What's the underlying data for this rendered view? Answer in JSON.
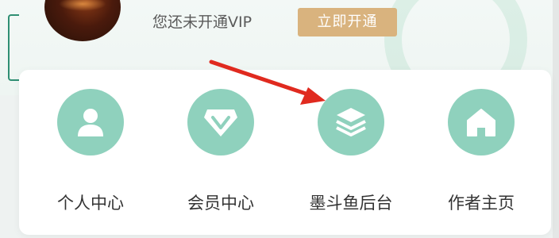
{
  "profile": {
    "vip_status": "您还未开通VIP",
    "vip_button_label": "立即开通"
  },
  "menu": {
    "items": [
      {
        "label": "个人中心",
        "icon": "person-icon"
      },
      {
        "label": "会员中心",
        "icon": "vip-diamond-icon"
      },
      {
        "label": "墨斗鱼后台",
        "icon": "layers-icon"
      },
      {
        "label": "作者主页",
        "icon": "home-icon"
      }
    ]
  },
  "colors": {
    "icon_circle": "#8fd1bd",
    "vip_button": "#d9b37e",
    "annotation_arrow": "#e02a1f"
  }
}
